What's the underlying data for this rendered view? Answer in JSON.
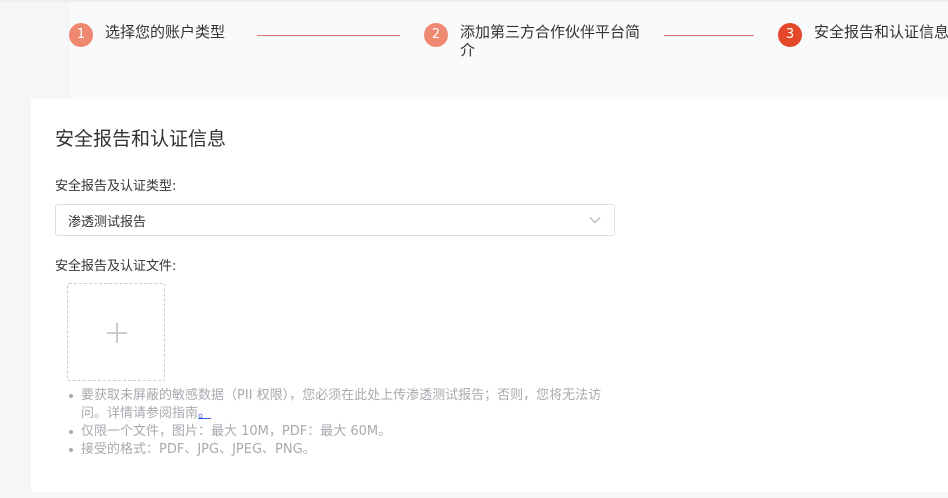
{
  "stepper": {
    "steps": [
      {
        "number": "1",
        "label": "选择您的账户类型",
        "state": "done"
      },
      {
        "number": "2",
        "label": "添加第三方合作伙伴平台简介",
        "state": "done"
      },
      {
        "number": "3",
        "label": "安全报告和认证信息",
        "state": "active"
      }
    ]
  },
  "form": {
    "title": "安全报告和认证信息",
    "type_label": "安全报告及认证类型:",
    "type_value": "渗透测试报告",
    "file_label": "安全报告及认证文件:",
    "notes": {
      "line1_text": "要获取未屏蔽的敏感数据（PII 权限），您必须在此处上传渗透测试报告；否则，您将无法访问。详情请参阅指南",
      "line1_link": "。",
      "line2": "仅限一个文件，图片：最大 10M，PDF：最大 60M。",
      "line3": "接受的格式：PDF、JPG、JPEG、PNG。"
    }
  },
  "colors": {
    "step_done": "#ef8870",
    "step_active": "#e5472a",
    "connector": "#e07b68",
    "hint_text": "#a7aaaf"
  },
  "icons": {
    "select_arrow": "chevron-down-icon",
    "upload": "plus-icon"
  }
}
